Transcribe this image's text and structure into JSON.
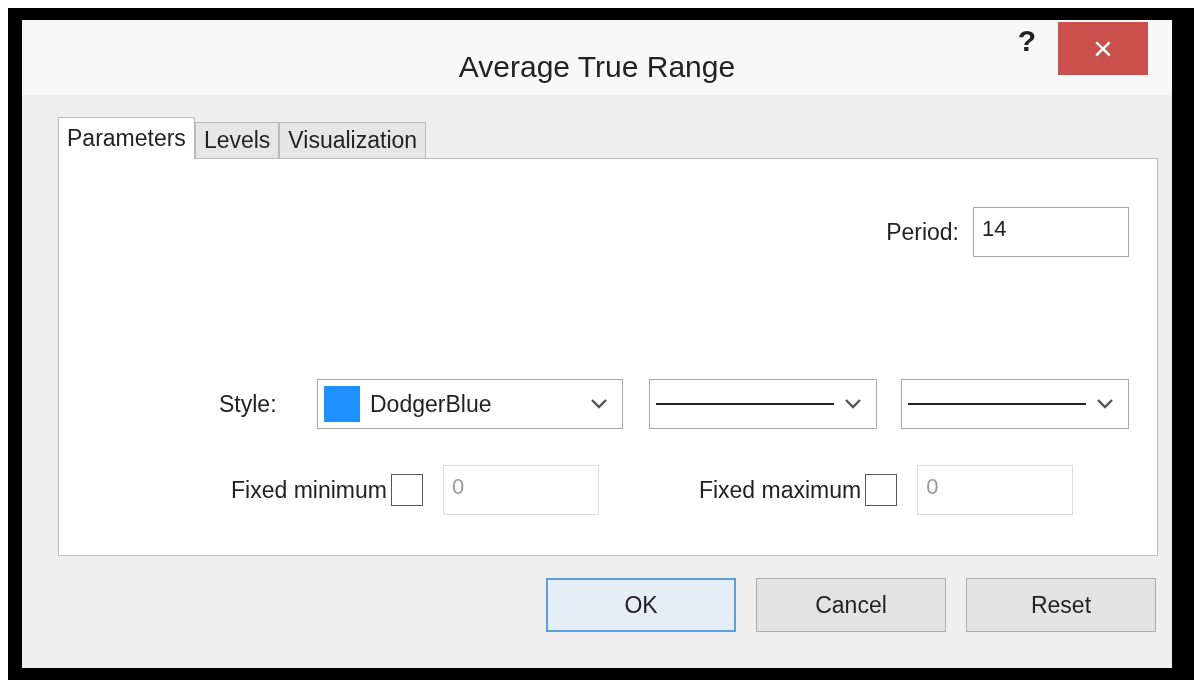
{
  "window": {
    "title": "Average True Range",
    "help": "?",
    "close": "×"
  },
  "tabs": [
    {
      "label": "Parameters",
      "selected": true
    },
    {
      "label": "Levels",
      "selected": false
    },
    {
      "label": "Visualization",
      "selected": false
    }
  ],
  "period": {
    "label": "Period:",
    "value": "14"
  },
  "style": {
    "label": "Style:",
    "color_name": "DodgerBlue",
    "color": "#1e90ff"
  },
  "fixed_limits": [
    {
      "label": "Fixed minimum",
      "checked": false,
      "value": "0",
      "disabled": true
    },
    {
      "label": "Fixed maximum",
      "checked": false,
      "value": "0",
      "disabled": true
    }
  ],
  "buttons": [
    {
      "label": "OK",
      "default": true
    },
    {
      "label": "Cancel",
      "default": false
    },
    {
      "label": "Reset",
      "default": false
    }
  ]
}
